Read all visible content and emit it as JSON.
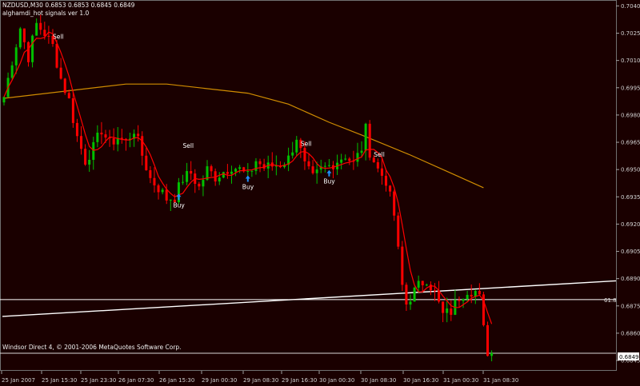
{
  "header": {
    "symbol_line": "NZDUSD,M30  0.6853 0.6853 0.6845 0.6849",
    "indicator_line": "alghamdi_hot signals ver 1.0"
  },
  "footer": {
    "copyright": "Windsor Direct 4, © 2001-2006 MetaQuotes Software Corp."
  },
  "colors": {
    "background": "#1a0000",
    "bull_candle": "#00c000",
    "bear_candle": "#ff0000",
    "ma_fast": "#ff0000",
    "ma_slow": "#d08c00",
    "trendline": "#ffffff",
    "buy_arrow": "#1e90ff",
    "signal_text": "#ffffff"
  },
  "fib_label": "61.8",
  "current_price_label": "0.6849",
  "chart_data": {
    "type": "candlestick",
    "symbol": "NZDUSD",
    "timeframe": "M30",
    "y_ticks": [
      "0.7040",
      "0.7025",
      "0.7010",
      "0.6995",
      "0.6980",
      "0.6965",
      "0.6950",
      "0.6935",
      "0.6920",
      "0.6905",
      "0.6890",
      "0.6875",
      "0.6860",
      "0.6845"
    ],
    "ylim": [
      0.68415,
      0.70415
    ],
    "x_ticks": [
      "25 Jan 2007",
      "25 Jan 15:30",
      "25 Jan 23:30",
      "26 Jan 07:30",
      "26 Jan 15:30",
      "29 Jan 00:30",
      "29 Jan 08:30",
      "29 Jan 16:30",
      "30 Jan 00:30",
      "30 Jan 08:30",
      "30 Jan 16:30",
      "31 Jan 00:30",
      "31 Jan 08:30"
    ],
    "grid": false,
    "horizontal_lines": [
      {
        "label": "61.8",
        "price": 0.68785
      },
      {
        "label": "0.6849",
        "price": 0.6849
      }
    ],
    "trendline": {
      "from": {
        "bar": 0,
        "price": 0.68692
      },
      "to": {
        "bar": 148,
        "price": 0.68888
      }
    },
    "signals": [
      {
        "type": "Sell",
        "bar": 12,
        "price": 0.7022
      },
      {
        "type": "Sell",
        "bar": 44,
        "price": 0.6962
      },
      {
        "type": "Buy",
        "bar": 43,
        "price": 0.6935
      },
      {
        "type": "Buy",
        "bar": 60,
        "price": 0.6945
      },
      {
        "type": "Sell",
        "bar": 73,
        "price": 0.6963
      },
      {
        "type": "Buy",
        "bar": 80,
        "price": 0.6948
      },
      {
        "type": "Sell",
        "bar": 91,
        "price": 0.6957
      }
    ],
    "anchors": [
      [
        0,
        0.699
      ],
      [
        2,
        0.701
      ],
      [
        4,
        0.7028
      ],
      [
        6,
        0.7012
      ],
      [
        8,
        0.703
      ],
      [
        10,
        0.7025
      ],
      [
        12,
        0.7018
      ],
      [
        14,
        0.7
      ],
      [
        16,
        0.6988
      ],
      [
        18,
        0.6968
      ],
      [
        20,
        0.6955
      ],
      [
        22,
        0.6962
      ],
      [
        24,
        0.6972
      ],
      [
        26,
        0.6964
      ],
      [
        28,
        0.6968
      ],
      [
        30,
        0.6965
      ],
      [
        32,
        0.6972
      ],
      [
        34,
        0.6958
      ],
      [
        36,
        0.6945
      ],
      [
        38,
        0.694
      ],
      [
        40,
        0.6934
      ],
      [
        42,
        0.6935
      ],
      [
        44,
        0.6945
      ],
      [
        46,
        0.6948
      ],
      [
        48,
        0.694
      ],
      [
        50,
        0.695
      ],
      [
        52,
        0.6946
      ],
      [
        54,
        0.6949
      ],
      [
        56,
        0.6952
      ],
      [
        58,
        0.695
      ],
      [
        60,
        0.6946
      ],
      [
        62,
        0.6955
      ],
      [
        64,
        0.6951
      ],
      [
        66,
        0.6952
      ],
      [
        68,
        0.6953
      ],
      [
        70,
        0.6956
      ],
      [
        72,
        0.6968
      ],
      [
        74,
        0.6952
      ],
      [
        76,
        0.6945
      ],
      [
        78,
        0.695
      ],
      [
        80,
        0.6952
      ],
      [
        82,
        0.6955
      ],
      [
        84,
        0.6958
      ],
      [
        86,
        0.6953
      ],
      [
        88,
        0.6962
      ],
      [
        89,
        0.6972
      ],
      [
        90,
        0.696
      ],
      [
        92,
        0.695
      ],
      [
        94,
        0.6944
      ],
      [
        96,
        0.6925
      ],
      [
        97,
        0.6905
      ],
      [
        98,
        0.6886
      ],
      [
        99,
        0.6876
      ],
      [
        100,
        0.688
      ],
      [
        102,
        0.6886
      ],
      [
        104,
        0.689
      ],
      [
        106,
        0.6882
      ],
      [
        107,
        0.6876
      ],
      [
        108,
        0.687
      ],
      [
        110,
        0.6872
      ],
      [
        112,
        0.688
      ],
      [
        114,
        0.6884
      ],
      [
        116,
        0.6883
      ],
      [
        117,
        0.6879
      ],
      [
        118,
        0.6862
      ],
      [
        119,
        0.685
      ],
      [
        120,
        0.6849
      ]
    ],
    "ma_slow": [
      [
        0,
        0.69892
      ],
      [
        30,
        0.6997
      ],
      [
        40,
        0.6997
      ],
      [
        60,
        0.6992
      ],
      [
        70,
        0.6986
      ],
      [
        80,
        0.6976
      ],
      [
        88,
        0.6969
      ],
      [
        100,
        0.6958
      ],
      [
        110,
        0.6948
      ],
      [
        118,
        0.694
      ]
    ]
  }
}
